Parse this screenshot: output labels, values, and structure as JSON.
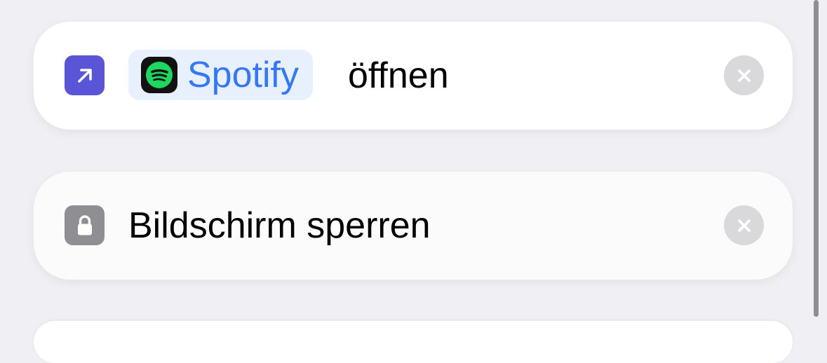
{
  "actions": [
    {
      "app_name": "Spotify",
      "verb": "öffnen",
      "action_icon": "open-app-arrow-icon",
      "app_icon": "spotify-icon",
      "remove_icon": "close-icon"
    },
    {
      "text": "Bildschirm sperren",
      "action_icon": "lock-icon",
      "remove_icon": "close-icon"
    }
  ],
  "colors": {
    "background": "#efeff4",
    "card": "#ffffff",
    "open_app_icon": "#5a55d6",
    "lock_icon": "#8e8e93",
    "token_background": "#e7f0fc",
    "token_text": "#3478f6",
    "spotify_green": "#1ed760",
    "remove_button": "#d9d9dc"
  }
}
